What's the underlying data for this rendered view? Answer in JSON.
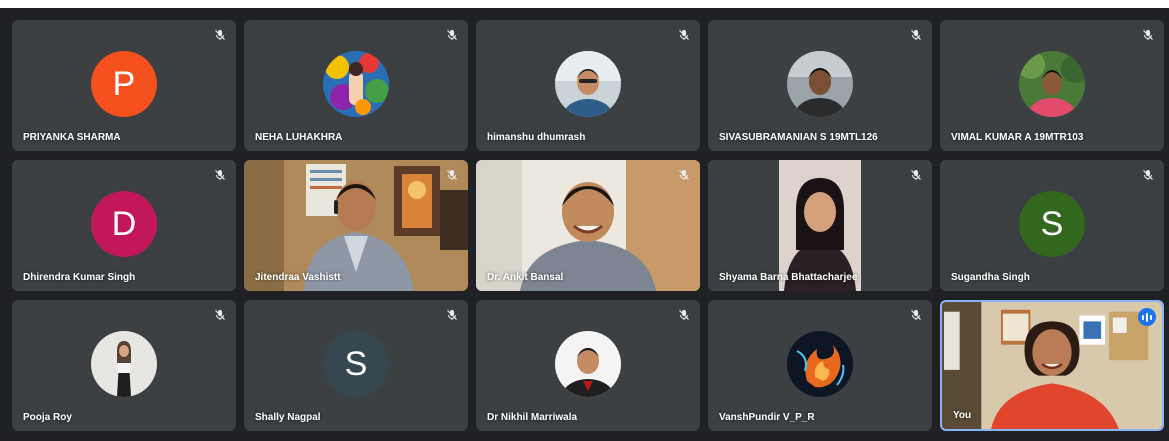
{
  "participants": [
    {
      "name": "PRIYANKA SHARMA",
      "avatar_letter": "P",
      "avatar_color": "#f4511e",
      "muted": true
    },
    {
      "name": "NEHA LUHAKHRA",
      "avatar_letter": "",
      "avatar_color": "#c9a23a",
      "muted": true
    },
    {
      "name": "himanshu dhumrash",
      "avatar_letter": "",
      "avatar_color": "#b7c4cc",
      "muted": true
    },
    {
      "name": "SIVASUBRAMANIAN S 19MTL126",
      "avatar_letter": "",
      "avatar_color": "#8f9aa0",
      "muted": true
    },
    {
      "name": "VIMAL KUMAR A 19MTR103",
      "avatar_letter": "",
      "avatar_color": "#4a7a3a",
      "muted": true
    },
    {
      "name": "Dhirendra Kumar Singh",
      "avatar_letter": "D",
      "avatar_color": "#c2185b",
      "muted": true
    },
    {
      "name": "Jitendraa Vashistt",
      "avatar_letter": "",
      "avatar_color": "",
      "muted": true
    },
    {
      "name": "Dr. Ankit Bansal",
      "avatar_letter": "",
      "avatar_color": "",
      "muted": true
    },
    {
      "name": "Shyama Barna Bhattacharjee",
      "avatar_letter": "",
      "avatar_color": "",
      "muted": true
    },
    {
      "name": "Sugandha Singh",
      "avatar_letter": "S",
      "avatar_color": "#33691e",
      "muted": true
    },
    {
      "name": "Pooja Roy",
      "avatar_letter": "",
      "avatar_color": "#e8e6e3",
      "muted": true
    },
    {
      "name": "Shally Nagpal",
      "avatar_letter": "S",
      "avatar_color": "#37474f",
      "muted": true
    },
    {
      "name": "Dr Nikhil Marriwala",
      "avatar_letter": "",
      "avatar_color": "#f2f2f2",
      "muted": true
    },
    {
      "name": "VanshPundir V_P_R",
      "avatar_letter": "",
      "avatar_color": "#1a2740",
      "muted": true
    },
    {
      "name": "You",
      "avatar_letter": "",
      "avatar_color": "",
      "muted": false
    }
  ],
  "colors": {
    "background": "#202124",
    "tile": "#3c4043",
    "active_border": "#8ab4f8",
    "speaking_badge": "#1a73e8"
  }
}
